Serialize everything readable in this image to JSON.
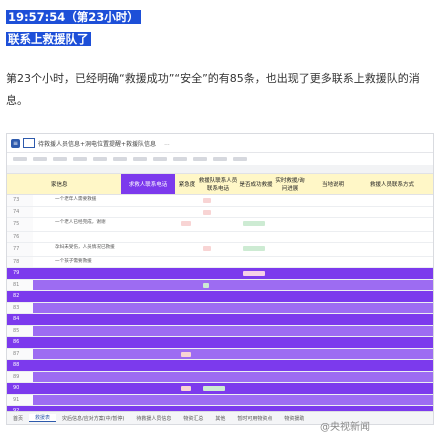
{
  "header": {
    "timestamp": "19:57:54（第23小时）",
    "headline": "联系上救援队了"
  },
  "paragraph": "第23个小时，已经明确“救援成功”“安全”的有85条，也出现了更多联系上救援队的消息。",
  "sheet": {
    "title": "待救援人员信息+洞电位置提醒+救援队信息",
    "toolbar_hint": "...",
    "header_columns": [
      "",
      "家信息",
      "求救人联系电话",
      "紧急度",
      "救援队联系人员联系电话",
      "是否成功救援",
      "实时救援/询问进展",
      "当地说明",
      "救援人员联系方式"
    ],
    "row_numbers": [
      "73",
      "74",
      "75",
      "76",
      "77",
      "78",
      "79",
      "81",
      "82",
      "83",
      "84",
      "85",
      "86",
      "87",
      "88",
      "89",
      "90",
      "91",
      "92",
      "93",
      "94",
      "95"
    ],
    "row_texts": [
      "一个老年人需要救援",
      "",
      "一个老人已经完成，谢谢",
      "",
      "孕妇未受伤，人员情况已救援",
      "一个孩子需要救援",
      "",
      "",
      "",
      "",
      "",
      "",
      "",
      "",
      "",
      "",
      "",
      "",
      "",
      "",
      "",
      ""
    ],
    "tabs": [
      "首页",
      "救援表",
      "灾后信息/应对方案(中/暂停)",
      "待救援人员信息",
      "物资汇总",
      "其他",
      "暂时可用物资点",
      "物资援助"
    ],
    "active_tab_index": 1,
    "colors": {
      "accent": "#1d4fd8",
      "purple": "#7c3aed",
      "header_yellow": "#fff7c7"
    }
  },
  "watermark": "@央视新闻"
}
